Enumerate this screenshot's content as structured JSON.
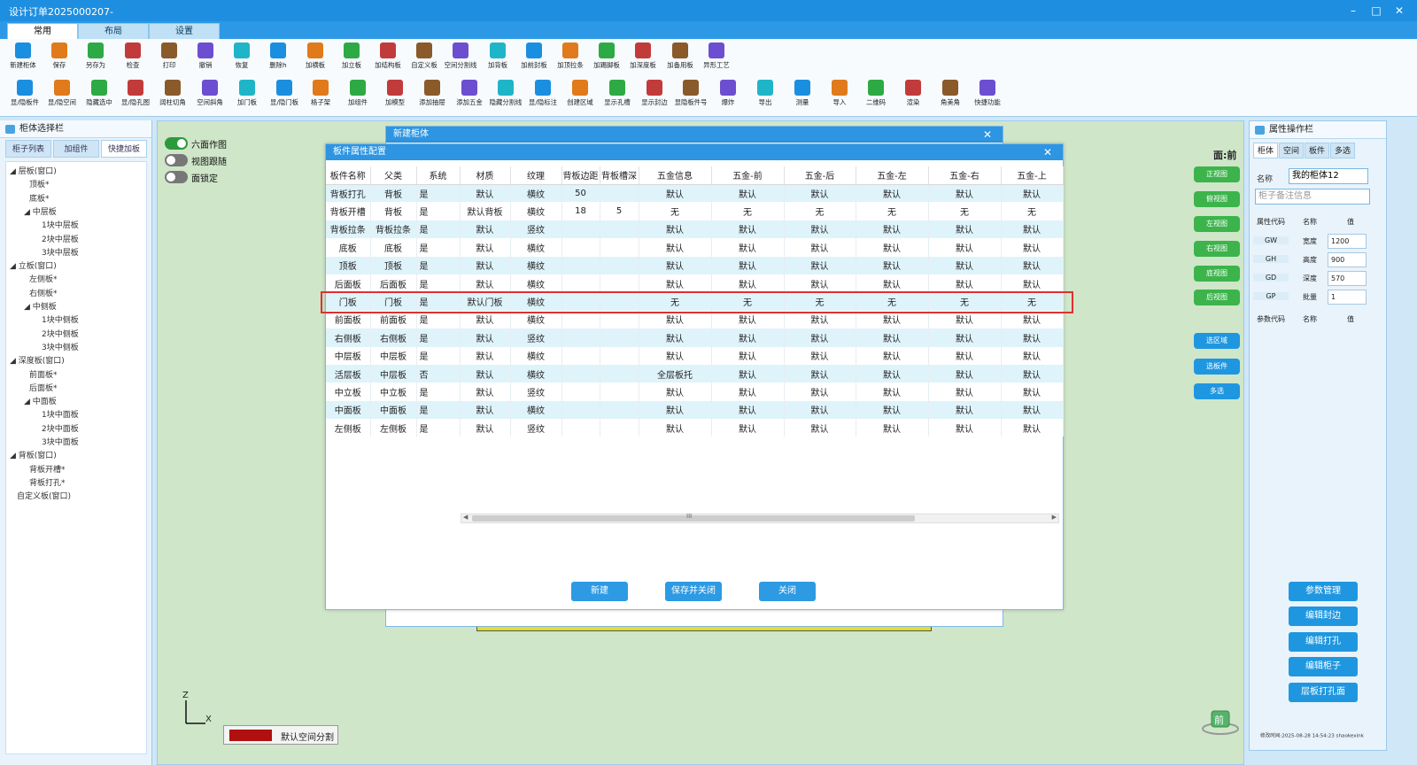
{
  "window": {
    "title": "设计订单2025000207-"
  },
  "ribbon_tabs": [
    "常用",
    "布局",
    "设置"
  ],
  "toolbar_row1": [
    "新建柜体",
    "保存",
    "另存为",
    "检查",
    "打印",
    "撤销",
    "恢复",
    "删除h",
    "加横板",
    "加立板",
    "加结构板",
    "自定义板",
    "空间分割线",
    "加背板",
    "加前封板",
    "加顶拉条",
    "加踢脚板",
    "加深度板",
    "加备用板",
    "异形工艺"
  ],
  "toolbar_row2": [
    "显/隐板件",
    "显/隐空间",
    "隐藏选中",
    "显/隐孔图",
    "阔柱切角",
    "空间斜角",
    "加门板",
    "显/隐门板",
    "格子架",
    "加组件",
    "加模型",
    "添加抽屉",
    "添加五金",
    "隐藏分割线",
    "显/隐标注",
    "创建区域",
    "显示孔槽",
    "显示封边",
    "显隐板件号",
    "爆炸",
    "导出",
    "测量",
    "导入",
    "二维码",
    "渲染",
    "角美角",
    "快捷功能"
  ],
  "left_panel": {
    "title": "柜体选择栏",
    "tabs": [
      "柜子列表",
      "加组件",
      "快捷加板"
    ],
    "tree": [
      "◢ 层板(窗口)",
      "顶板*",
      "底板*",
      "◢ 中层板",
      "1块中层板",
      "2块中层板",
      "3块中层板",
      "◢ 立板(窗口)",
      "左侧板*",
      "右侧板*",
      "◢ 中侧板",
      "1块中侧板",
      "2块中侧板",
      "3块中侧板",
      "◢ 深度板(窗口)",
      "前面板*",
      "后面板*",
      "◢ 中面板",
      "1块中面板",
      "2块中面板",
      "3块中面板",
      "◢ 背板(窗口)",
      "背板开槽*",
      "背板打孔*",
      "自定义板(窗口)"
    ]
  },
  "canvas": {
    "toggles": [
      "六面作图",
      "视图跟随",
      "面锁定"
    ],
    "view_label": "面:前",
    "view_buttons": [
      "正视图",
      "俯视图",
      "左视图",
      "右视图",
      "底视图",
      "后视图"
    ],
    "select_buttons": [
      "选区域",
      "选板件",
      "多选"
    ],
    "space_label": "默认空间分割",
    "axis": {
      "z": "Z",
      "x": "X"
    },
    "front_badge": "前"
  },
  "outer_dialog": {
    "title": "新建柜体"
  },
  "inner_dialog": {
    "title": "板件属性配置",
    "columns": [
      "板件名称",
      "父类",
      "系统",
      "材质",
      "纹理",
      "背板边距",
      "背板槽深",
      "五金信息",
      "五金-前",
      "五金-后",
      "五金-左",
      "五金-右",
      "五金-上"
    ],
    "rows": [
      [
        "背板打孔",
        "背板",
        "是",
        "默认",
        "横纹",
        "50",
        "",
        "默认",
        "默认",
        "默认",
        "默认",
        "默认",
        "默认"
      ],
      [
        "背板开槽",
        "背板",
        "是",
        "默认背板",
        "横纹",
        "18",
        "5",
        "无",
        "无",
        "无",
        "无",
        "无",
        "无"
      ],
      [
        "背板拉条",
        "背板拉条",
        "是",
        "默认",
        "竖纹",
        "",
        "",
        "默认",
        "默认",
        "默认",
        "默认",
        "默认",
        "默认"
      ],
      [
        "底板",
        "底板",
        "是",
        "默认",
        "横纹",
        "",
        "",
        "默认",
        "默认",
        "默认",
        "默认",
        "默认",
        "默认"
      ],
      [
        "顶板",
        "顶板",
        "是",
        "默认",
        "横纹",
        "",
        "",
        "默认",
        "默认",
        "默认",
        "默认",
        "默认",
        "默认"
      ],
      [
        "后面板",
        "后面板",
        "是",
        "默认",
        "横纹",
        "",
        "",
        "默认",
        "默认",
        "默认",
        "默认",
        "默认",
        "默认"
      ],
      [
        "门板",
        "门板",
        "是",
        "默认门板",
        "横纹",
        "",
        "",
        "无",
        "无",
        "无",
        "无",
        "无",
        "无"
      ],
      [
        "前面板",
        "前面板",
        "是",
        "默认",
        "横纹",
        "",
        "",
        "默认",
        "默认",
        "默认",
        "默认",
        "默认",
        "默认"
      ],
      [
        "右侧板",
        "右侧板",
        "是",
        "默认",
        "竖纹",
        "",
        "",
        "默认",
        "默认",
        "默认",
        "默认",
        "默认",
        "默认"
      ],
      [
        "中层板",
        "中层板",
        "是",
        "默认",
        "横纹",
        "",
        "",
        "默认",
        "默认",
        "默认",
        "默认",
        "默认",
        "默认"
      ],
      [
        "活层板",
        "中层板",
        "否",
        "默认",
        "横纹",
        "",
        "",
        "全层板托",
        "默认",
        "默认",
        "默认",
        "默认",
        "默认"
      ],
      [
        "中立板",
        "中立板",
        "是",
        "默认",
        "竖纹",
        "",
        "",
        "默认",
        "默认",
        "默认",
        "默认",
        "默认",
        "默认"
      ],
      [
        "中面板",
        "中面板",
        "是",
        "默认",
        "横纹",
        "",
        "",
        "默认",
        "默认",
        "默认",
        "默认",
        "默认",
        "默认"
      ],
      [
        "左侧板",
        "左侧板",
        "是",
        "默认",
        "竖纹",
        "",
        "",
        "默认",
        "默认",
        "默认",
        "默认",
        "默认",
        "默认"
      ]
    ],
    "buttons": [
      "新建",
      "保存并关闭",
      "关闭"
    ],
    "scroll_marker": "III"
  },
  "right_panel": {
    "title": "属性操作栏",
    "tabs": [
      "柜体",
      "空间",
      "板件",
      "多选"
    ],
    "name_label": "名称",
    "name_value": "我的柜体12",
    "note_placeholder": "柜子备注信息",
    "prop_header": [
      "属性代码",
      "名称",
      "值"
    ],
    "props": [
      {
        "code": "GW",
        "name": "宽度",
        "value": "1200"
      },
      {
        "code": "GH",
        "name": "高度",
        "value": "900"
      },
      {
        "code": "GD",
        "name": "深度",
        "value": "570"
      },
      {
        "code": "GP",
        "name": "批量",
        "value": "1"
      }
    ],
    "param_header": [
      "参数代码",
      "名称",
      "值"
    ],
    "buttons": [
      "参数管理",
      "编辑封边",
      "编辑打孔",
      "编辑柜子",
      "层板打孔面"
    ],
    "footer": "修改时间:2025-08-28 14:54:23 shaokexink"
  },
  "colors": {
    "titlebar": "#1e8fe0",
    "accent": "#2d95e2",
    "highlight": "#e03030",
    "green": "#3cb44b"
  }
}
